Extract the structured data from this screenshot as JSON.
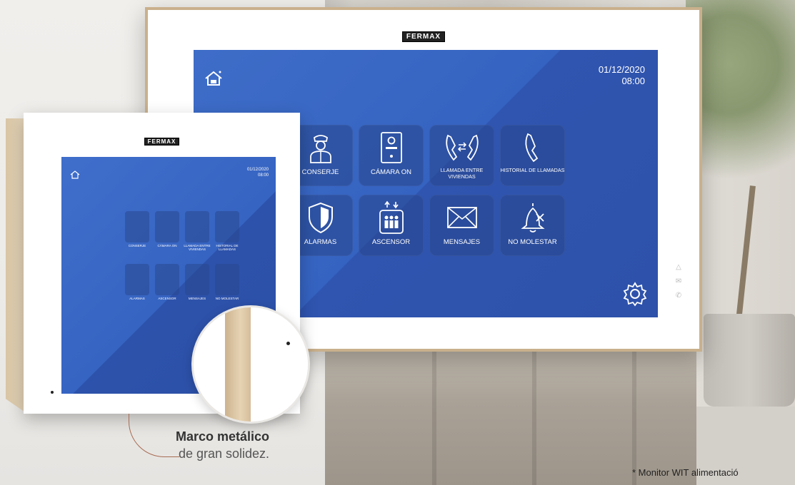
{
  "monitor": {
    "brand": "FERMAX",
    "date": "01/12/2020",
    "time": "08:00",
    "tiles": [
      {
        "label": "CONSERJE",
        "icon": "concierge-icon"
      },
      {
        "label": "CÁMARA ON",
        "icon": "camera-panel-icon"
      },
      {
        "label": "LLAMADA ENTRE VIVIENDAS",
        "icon": "intercom-call-icon"
      },
      {
        "label": "HISTORIAL DE LLAMADAS",
        "icon": "phone-history-icon"
      },
      {
        "label": "ALARMAS",
        "icon": "shield-icon"
      },
      {
        "label": "ASCENSOR",
        "icon": "elevator-icon"
      },
      {
        "label": "MENSAJES",
        "icon": "envelope-icon"
      },
      {
        "label": "NO MOLESTAR",
        "icon": "bell-off-icon"
      }
    ]
  },
  "small_monitor": {
    "brand": "FERMAX",
    "date": "01/12/2020",
    "time": "08:00",
    "tiles": [
      "CONSERJE",
      "CÁMARA ON",
      "LLAMADA ENTRE VIVIENDAS",
      "HISTORIAL DE LLAMADAS",
      "ALARMAS",
      "ASCENSOR",
      "MENSAJES",
      "NO MOLESTAR"
    ]
  },
  "caption": {
    "title": "Marco metálico",
    "subtitle": "de gran solidez."
  },
  "footnote": "* Monitor WIT alimentació"
}
